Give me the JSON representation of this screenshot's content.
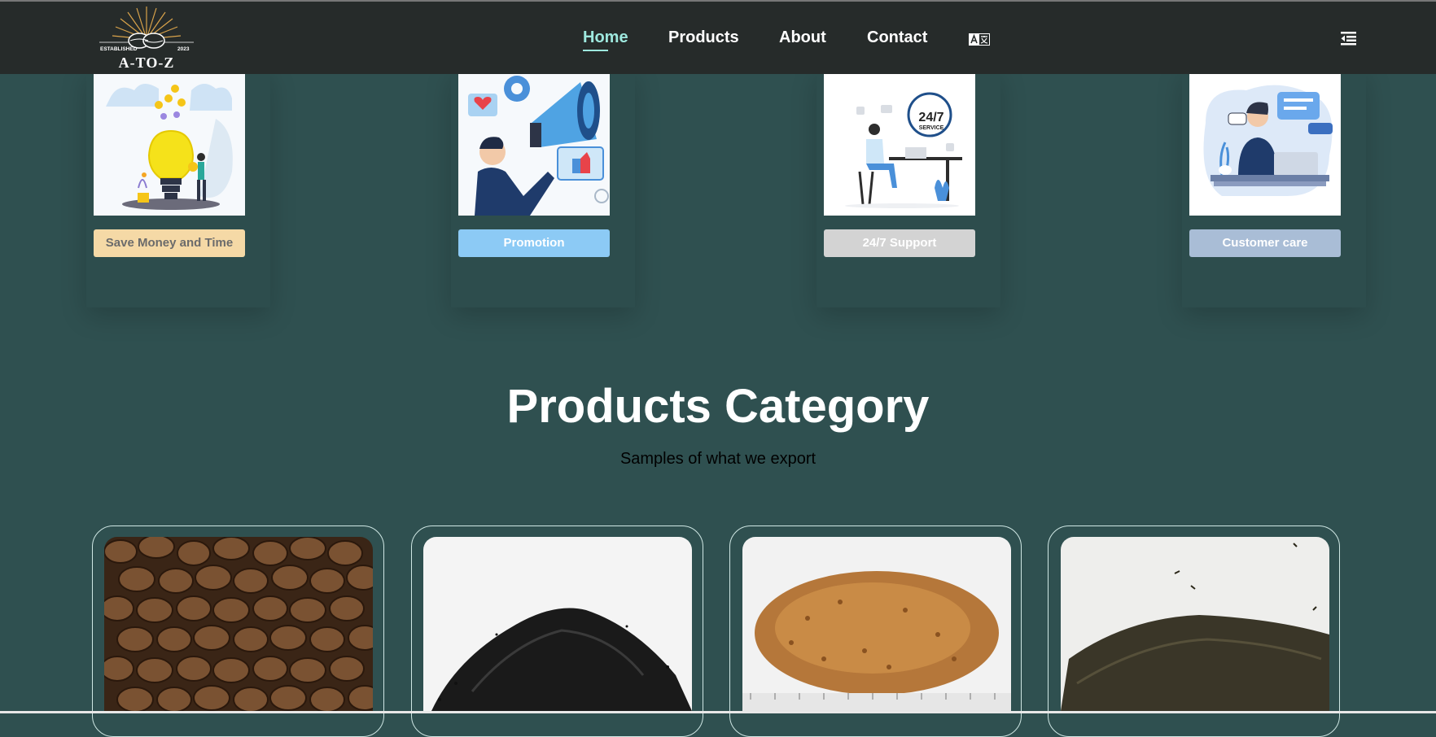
{
  "brand": {
    "top_text_left": "ESTABLISHED",
    "top_text_right": "2023",
    "name": "A-TO-Z"
  },
  "nav": {
    "items": [
      {
        "label": "Home",
        "active": true
      },
      {
        "label": "Products",
        "active": false
      },
      {
        "label": "About",
        "active": false
      },
      {
        "label": "Contact",
        "active": false
      }
    ],
    "translate_icon": "translate-icon",
    "menu_icon": "menu-collapse-icon"
  },
  "features": [
    {
      "label": "Save Money and Time",
      "color": "#f5d9a6",
      "text_color": "#6b6b6b"
    },
    {
      "label": "Promotion",
      "color": "#8ccaf5",
      "text_color": "#ffffff"
    },
    {
      "label": "24/7 Support",
      "color": "#d3d3d3",
      "text_color": "#ffffff"
    },
    {
      "label": "Customer care",
      "color": "#a9bdd6",
      "text_color": "#ffffff"
    }
  ],
  "products_section": {
    "title": "Products Category",
    "subtitle": "Samples of what we export"
  },
  "colors": {
    "navbar": "#262b2a",
    "background": "#2f5050",
    "accent": "#9ee8de"
  }
}
